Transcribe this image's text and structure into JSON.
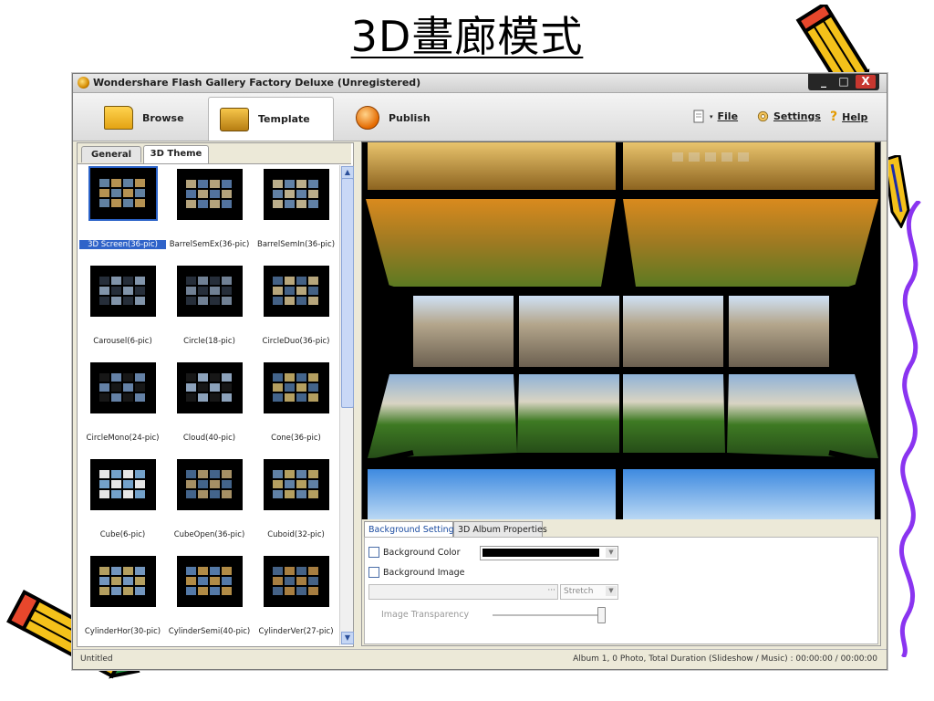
{
  "slide": {
    "title": "3D畫廊模式"
  },
  "window": {
    "title": "Wondershare Flash Gallery Factory Deluxe (Unregistered)",
    "buttons": {
      "minimize": "_",
      "maximize": "□",
      "close": "X"
    }
  },
  "toolbar": {
    "tabs": [
      {
        "label": "Browse",
        "icon": "folder-icon"
      },
      {
        "label": "Template",
        "icon": "template-icon"
      },
      {
        "label": "Publish",
        "icon": "publish-icon"
      }
    ],
    "active_tab": "Template",
    "menu": [
      {
        "label": "File",
        "icon": "file-icon"
      },
      {
        "label": "Settings",
        "icon": "settings-icon"
      },
      {
        "label": "Help",
        "icon": "help-icon"
      }
    ]
  },
  "left_panel": {
    "tabs": [
      {
        "label": "General"
      },
      {
        "label": "3D Theme"
      }
    ],
    "active_tab": "3D Theme",
    "thumbnails": [
      {
        "label": "3D Screen(36-pic)"
      },
      {
        "label": "BarrelSemEx(36-pic)"
      },
      {
        "label": "BarrelSemIn(36-pic)"
      },
      {
        "label": "Carousel(6-pic)"
      },
      {
        "label": "Circle(18-pic)"
      },
      {
        "label": "CircleDuo(36-pic)"
      },
      {
        "label": "CircleMono(24-pic)"
      },
      {
        "label": "Cloud(40-pic)"
      },
      {
        "label": "Cone(36-pic)"
      },
      {
        "label": "Cube(6-pic)"
      },
      {
        "label": "CubeOpen(36-pic)"
      },
      {
        "label": "Cuboid(32-pic)"
      },
      {
        "label": "CylinderHor(30-pic)"
      },
      {
        "label": "CylinderSemi(40-pic)"
      },
      {
        "label": "CylinderVer(27-pic)"
      }
    ],
    "selected": "3D Screen(36-pic)"
  },
  "settings_panel": {
    "tabs": [
      {
        "label": "Background Settings"
      },
      {
        "label": "3D Album Properties"
      }
    ],
    "active_tab": "Background Settings",
    "background_color_label": "Background Color",
    "background_color_value": "#000000",
    "background_image_label": "Background Image",
    "image_path_value": "",
    "browse_label": "···",
    "stretch_value": "Stretch",
    "transparency_label": "Image Transparency",
    "transparency_value": 1.0
  },
  "status": {
    "left": "Untitled",
    "right": "Album 1, 0 Photo, Total Duration (Slideshow / Music) : 00:00:00 / 00:00:00"
  },
  "colors": {
    "window_bg": "#ECE9D8",
    "selection": "#2f63c9",
    "close_button": "#c7372f"
  }
}
